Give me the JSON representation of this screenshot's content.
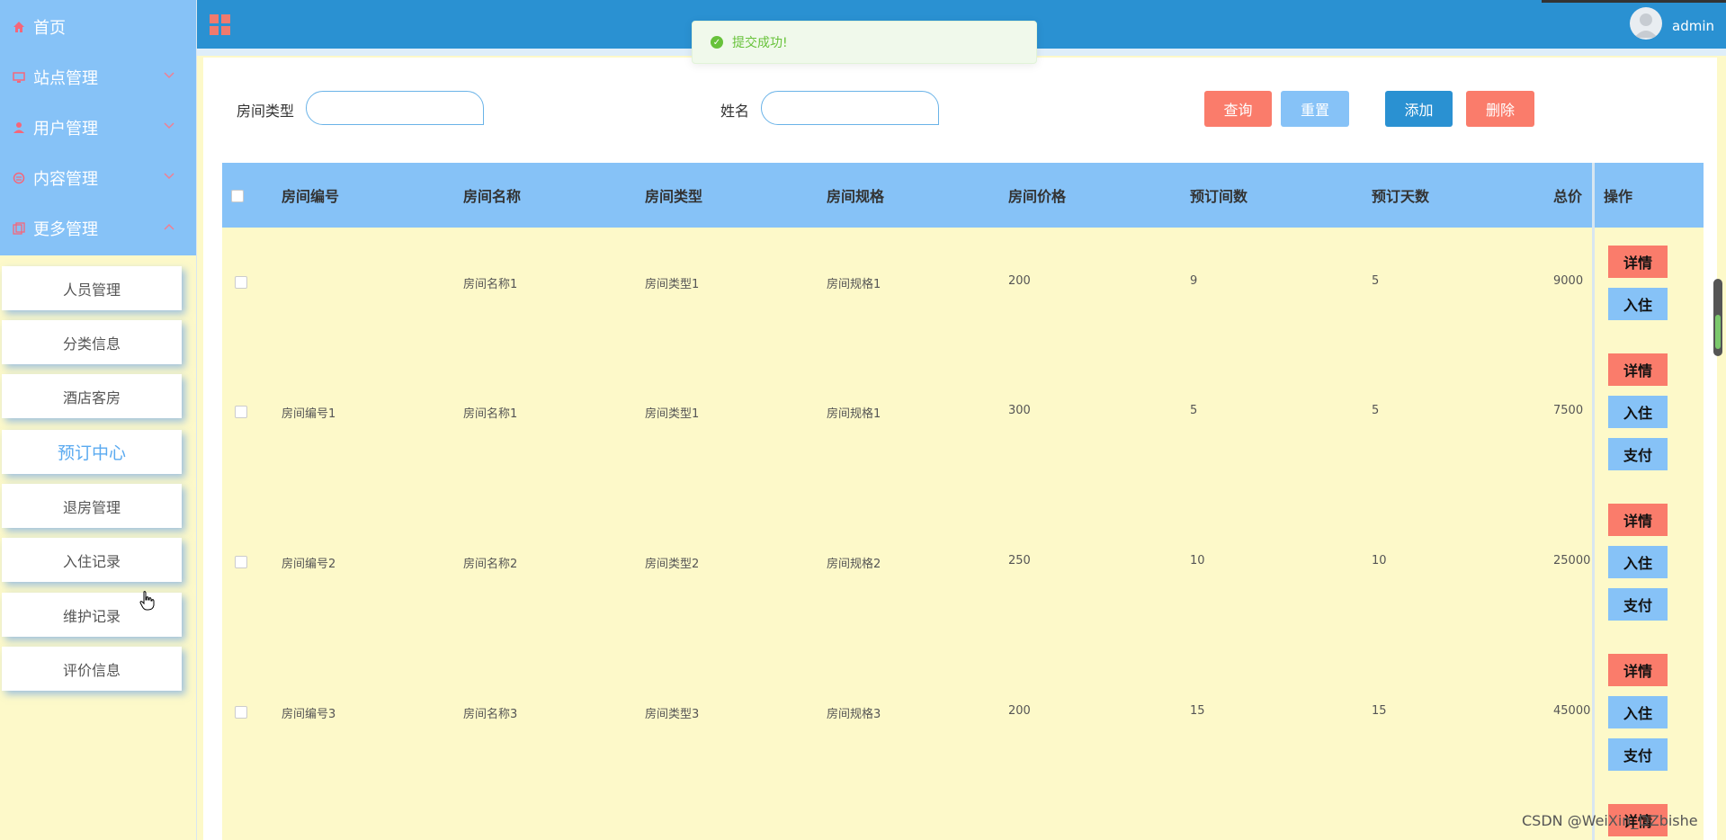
{
  "header": {
    "title": "",
    "username": "admin"
  },
  "toast": {
    "message": "提交成功!"
  },
  "sidebar": {
    "menu": [
      {
        "label": "首页",
        "icon": "home-icon"
      },
      {
        "label": "站点管理",
        "icon": "monitor-icon"
      },
      {
        "label": "用户管理",
        "icon": "user-icon"
      },
      {
        "label": "内容管理",
        "icon": "content-icon"
      },
      {
        "label": "更多管理",
        "icon": "copy-icon"
      }
    ],
    "submenu": [
      {
        "label": "人员管理"
      },
      {
        "label": "分类信息"
      },
      {
        "label": "酒店客房"
      },
      {
        "label": "预订中心",
        "active": true
      },
      {
        "label": "退房管理"
      },
      {
        "label": "入住记录"
      },
      {
        "label": "维护记录"
      },
      {
        "label": "评价信息"
      }
    ]
  },
  "search": {
    "room_type_label": "房间类型",
    "room_type_value": "",
    "name_label": "姓名",
    "name_value": "",
    "query_button": "查询",
    "reset_button": "重置",
    "add_button": "添加",
    "delete_button": "删除"
  },
  "table": {
    "columns": [
      "房间编号",
      "房间名称",
      "房间类型",
      "房间规格",
      "房间价格",
      "预订间数",
      "预订天数",
      "总价",
      "操作"
    ],
    "actions": {
      "detail": "详情",
      "checkin": "入住",
      "pay": "支付"
    },
    "rows": [
      {
        "room_no": "",
        "room_name": "房间名称1",
        "room_type": "房间类型1",
        "room_spec": "房间规格1",
        "price": "200",
        "rooms": "9",
        "days": "5",
        "total": "9000",
        "has_pay": false
      },
      {
        "room_no": "房间编号1",
        "room_name": "房间名称1",
        "room_type": "房间类型1",
        "room_spec": "房间规格1",
        "price": "300",
        "rooms": "5",
        "days": "5",
        "total": "7500",
        "has_pay": true
      },
      {
        "room_no": "房间编号2",
        "room_name": "房间名称2",
        "room_type": "房间类型2",
        "room_spec": "房间规格2",
        "price": "250",
        "rooms": "10",
        "days": "10",
        "total": "25000",
        "has_pay": true
      },
      {
        "room_no": "房间编号3",
        "room_name": "房间名称3",
        "room_type": "房间类型3",
        "room_spec": "房间规格3",
        "price": "200",
        "rooms": "15",
        "days": "15",
        "total": "45000",
        "has_pay": true
      }
    ],
    "partial_row_action": "详情"
  },
  "watermark": "CSDN @WeiXin_DZbishe",
  "colors": {
    "sidebar_blue": "#86c2f7",
    "header_blue": "#2a91d2",
    "accent_red": "#fa7c6b",
    "row_yellow": "#fdf9c9",
    "success_green": "#67c23a"
  }
}
